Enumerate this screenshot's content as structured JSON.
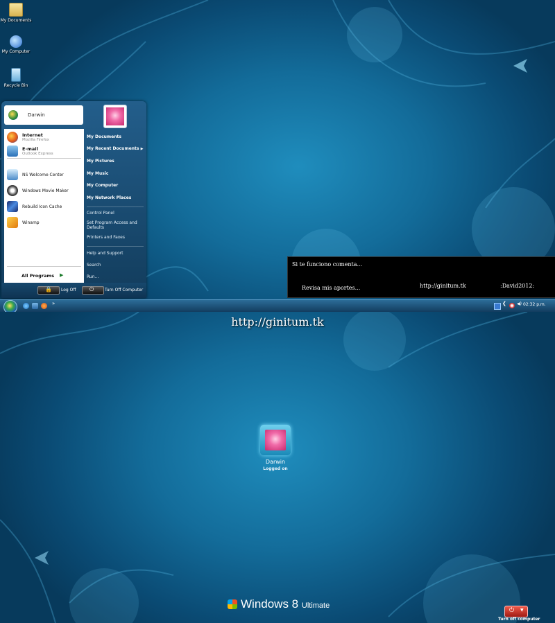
{
  "desktop": {
    "icons": [
      {
        "label": "My Documents",
        "icon": "folder-icon"
      },
      {
        "label": "My Computer",
        "icon": "computer-icon"
      },
      {
        "label": "Recycle Bin",
        "icon": "recycle-bin-icon"
      }
    ]
  },
  "start_menu": {
    "user_name": "Darwin",
    "pinned": [
      {
        "title": "Internet",
        "subtitle": "Mozilla Firefox",
        "icon": "firefox-icon"
      },
      {
        "title": "E-mail",
        "subtitle": "Outlook Express",
        "icon": "outlook-icon"
      }
    ],
    "recent": [
      {
        "label": "NS Welcome Center",
        "icon": "welcome-center-icon"
      },
      {
        "label": "Windows Movie Maker",
        "icon": "movie-maker-icon"
      },
      {
        "label": "Rebuild Icon Cache",
        "icon": "rebuild-icon-cache-icon"
      },
      {
        "label": "Winamp",
        "icon": "winamp-icon"
      }
    ],
    "all_programs": "All Programs",
    "right_bold": [
      "My Documents",
      "My Recent Documents",
      "My Pictures",
      "My Music",
      "My Computer",
      "My Network Places"
    ],
    "right_normal_1": [
      "Control Panel",
      "Set Program Access and Defaults",
      "Printers and Faxes"
    ],
    "right_normal_2": [
      "Help and Support",
      "Search",
      "Run..."
    ],
    "log_off": "Log Off",
    "turn_off": "Turn Off Computer"
  },
  "notification": {
    "line1": "Si te funciono comenta...",
    "line2": "Revisa mis aportes...",
    "line3": "http://ginitum.tk",
    "line4": ":David2012:"
  },
  "taskbar": {
    "more": "»",
    "clock": "02:32 p.m."
  },
  "login": {
    "site_title": "http://ginitum.tk",
    "user_name": "Darwin",
    "status": "Logged on",
    "brand_word": "Windows 8",
    "brand_edition": "Ultimate",
    "shutdown_label": "Turn off computer"
  },
  "colors": {
    "background": "#0a4a73",
    "accent": "#1f8dbd",
    "shutdown": "#d8342a"
  }
}
